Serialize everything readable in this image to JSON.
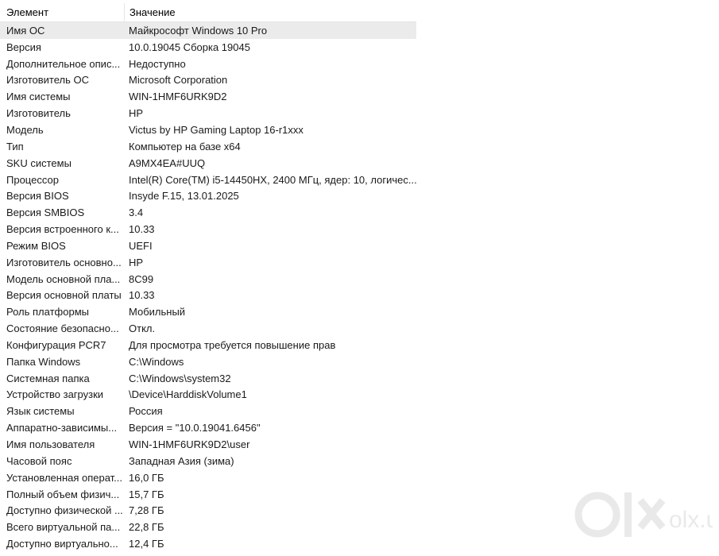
{
  "columns": {
    "element": "Элемент",
    "value": "Значение"
  },
  "rows": [
    {
      "name": "Имя ОС",
      "value": "Майкрософт Windows 10 Pro",
      "selected": true
    },
    {
      "name": "Версия",
      "value": "10.0.19045 Сборка 19045"
    },
    {
      "name": "Дополнительное опис...",
      "value": "Недоступно"
    },
    {
      "name": "Изготовитель ОС",
      "value": "Microsoft Corporation"
    },
    {
      "name": "Имя системы",
      "value": "WIN-1HMF6URK9D2"
    },
    {
      "name": "Изготовитель",
      "value": "HP"
    },
    {
      "name": "Модель",
      "value": "Victus by HP Gaming Laptop 16-r1xxx"
    },
    {
      "name": "Тип",
      "value": "Компьютер на базе x64"
    },
    {
      "name": "SKU системы",
      "value": "A9MX4EA#UUQ"
    },
    {
      "name": "Процессор",
      "value": "Intel(R) Core(TM) i5-14450HX, 2400 МГц, ядер: 10, логичес..."
    },
    {
      "name": "Версия BIOS",
      "value": "Insyde F.15, 13.01.2025"
    },
    {
      "name": "Версия SMBIOS",
      "value": "3.4"
    },
    {
      "name": "Версия встроенного к...",
      "value": "10.33"
    },
    {
      "name": "Режим BIOS",
      "value": "UEFI"
    },
    {
      "name": "Изготовитель основно...",
      "value": "HP"
    },
    {
      "name": "Модель основной пла...",
      "value": "8C99"
    },
    {
      "name": "Версия основной платы",
      "value": "10.33"
    },
    {
      "name": "Роль платформы",
      "value": "Мобильный"
    },
    {
      "name": "Состояние безопасно...",
      "value": "Откл."
    },
    {
      "name": "Конфигурация PCR7",
      "value": "Для просмотра требуется повышение прав"
    },
    {
      "name": "Папка Windows",
      "value": "C:\\Windows"
    },
    {
      "name": "Системная папка",
      "value": "C:\\Windows\\system32"
    },
    {
      "name": "Устройство загрузки",
      "value": "\\Device\\HarddiskVolume1"
    },
    {
      "name": "Язык системы",
      "value": "Россия"
    },
    {
      "name": "Аппаратно-зависимы...",
      "value": "Версия = \"10.0.19041.6456\""
    },
    {
      "name": "Имя пользователя",
      "value": "WIN-1HMF6URK9D2\\user"
    },
    {
      "name": "Часовой пояс",
      "value": "Западная Азия (зима)"
    },
    {
      "name": "Установленная операт...",
      "value": "16,0 ГБ"
    },
    {
      "name": "Полный объем физич...",
      "value": "15,7 ГБ"
    },
    {
      "name": "Доступно физической ...",
      "value": "7,28 ГБ"
    },
    {
      "name": "Всего виртуальной па...",
      "value": "22,8 ГБ"
    },
    {
      "name": "Доступно виртуально...",
      "value": "12,4 ГБ"
    }
  ],
  "watermark": {
    "text": "olx.uz",
    "icon": "olx-logo-icon",
    "color": "#d9d9d9"
  },
  "colors": {
    "selected_row": "#ebebeb",
    "header_border": "#e5e5e5"
  }
}
